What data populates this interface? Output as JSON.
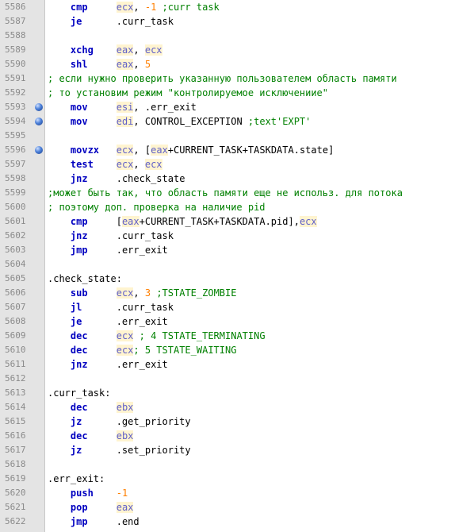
{
  "editor": {
    "lines": [
      {
        "n": "5586",
        "bp": false,
        "tokens": [
          {
            "t": "    ",
            "c": "txt"
          },
          {
            "t": "cmp",
            "c": "kw"
          },
          {
            "t": "     ",
            "c": "txt"
          },
          {
            "t": "ecx",
            "c": "reg"
          },
          {
            "t": ", ",
            "c": "txt"
          },
          {
            "t": "-1",
            "c": "num"
          },
          {
            "t": " ;curr task",
            "c": "cmt"
          }
        ]
      },
      {
        "n": "5587",
        "bp": false,
        "tokens": [
          {
            "t": "    ",
            "c": "txt"
          },
          {
            "t": "je",
            "c": "kw"
          },
          {
            "t": "      .curr_task",
            "c": "txt"
          }
        ]
      },
      {
        "n": "5588",
        "bp": false,
        "tokens": []
      },
      {
        "n": "5589",
        "bp": false,
        "tokens": [
          {
            "t": "    ",
            "c": "txt"
          },
          {
            "t": "xchg",
            "c": "kw"
          },
          {
            "t": "    ",
            "c": "txt"
          },
          {
            "t": "eax",
            "c": "reg"
          },
          {
            "t": ", ",
            "c": "txt"
          },
          {
            "t": "ecx",
            "c": "reg"
          }
        ]
      },
      {
        "n": "5590",
        "bp": false,
        "tokens": [
          {
            "t": "    ",
            "c": "txt"
          },
          {
            "t": "shl",
            "c": "kw"
          },
          {
            "t": "     ",
            "c": "txt"
          },
          {
            "t": "eax",
            "c": "reg"
          },
          {
            "t": ", ",
            "c": "txt"
          },
          {
            "t": "5",
            "c": "num"
          }
        ]
      },
      {
        "n": "5591",
        "bp": false,
        "tokens": [
          {
            "t": "; если нужно проверить указанную пользователем область памяти",
            "c": "cmt"
          }
        ]
      },
      {
        "n": "5592",
        "bp": false,
        "tokens": [
          {
            "t": "; то установим режим \"контролируемое исключениие\"",
            "c": "cmt"
          }
        ]
      },
      {
        "n": "5593",
        "bp": true,
        "tokens": [
          {
            "t": "    ",
            "c": "txt"
          },
          {
            "t": "mov",
            "c": "kw"
          },
          {
            "t": "     ",
            "c": "txt"
          },
          {
            "t": "esi",
            "c": "reg"
          },
          {
            "t": ", .err_exit",
            "c": "txt"
          }
        ]
      },
      {
        "n": "5594",
        "bp": true,
        "tokens": [
          {
            "t": "    ",
            "c": "txt"
          },
          {
            "t": "mov",
            "c": "kw"
          },
          {
            "t": "     ",
            "c": "txt"
          },
          {
            "t": "edi",
            "c": "reg"
          },
          {
            "t": ", CONTROL_EXCEPTION ",
            "c": "txt"
          },
          {
            "t": ";text'EXPT'",
            "c": "cmt"
          }
        ]
      },
      {
        "n": "5595",
        "bp": false,
        "tokens": []
      },
      {
        "n": "5596",
        "bp": true,
        "tokens": [
          {
            "t": "    ",
            "c": "txt"
          },
          {
            "t": "movzx",
            "c": "kw"
          },
          {
            "t": "   ",
            "c": "txt"
          },
          {
            "t": "ecx",
            "c": "reg"
          },
          {
            "t": ", [",
            "c": "txt"
          },
          {
            "t": "eax",
            "c": "reg"
          },
          {
            "t": "+CURRENT_TASK+TASKDATA.state]",
            "c": "txt"
          }
        ]
      },
      {
        "n": "5597",
        "bp": false,
        "tokens": [
          {
            "t": "    ",
            "c": "txt"
          },
          {
            "t": "test",
            "c": "kw"
          },
          {
            "t": "    ",
            "c": "txt"
          },
          {
            "t": "ecx",
            "c": "reg"
          },
          {
            "t": ", ",
            "c": "txt"
          },
          {
            "t": "ecx",
            "c": "reg"
          }
        ]
      },
      {
        "n": "5598",
        "bp": false,
        "tokens": [
          {
            "t": "    ",
            "c": "txt"
          },
          {
            "t": "jnz",
            "c": "kw"
          },
          {
            "t": "     .check_state",
            "c": "txt"
          }
        ]
      },
      {
        "n": "5599",
        "bp": false,
        "tokens": [
          {
            "t": ";может быть так, что область памяти еще не использ. для потока",
            "c": "cmt"
          }
        ]
      },
      {
        "n": "5600",
        "bp": false,
        "tokens": [
          {
            "t": "; поэтому доп. проверка на наличие pid",
            "c": "cmt"
          }
        ]
      },
      {
        "n": "5601",
        "bp": false,
        "tokens": [
          {
            "t": "    ",
            "c": "txt"
          },
          {
            "t": "cmp",
            "c": "kw"
          },
          {
            "t": "     [",
            "c": "txt"
          },
          {
            "t": "eax",
            "c": "reg"
          },
          {
            "t": "+CURRENT_TASK+TASKDATA.pid],",
            "c": "txt"
          },
          {
            "t": "ecx",
            "c": "reg"
          }
        ]
      },
      {
        "n": "5602",
        "bp": false,
        "tokens": [
          {
            "t": "    ",
            "c": "txt"
          },
          {
            "t": "jnz",
            "c": "kw"
          },
          {
            "t": "     .curr_task",
            "c": "txt"
          }
        ]
      },
      {
        "n": "5603",
        "bp": false,
        "tokens": [
          {
            "t": "    ",
            "c": "txt"
          },
          {
            "t": "jmp",
            "c": "kw"
          },
          {
            "t": "     .err_exit",
            "c": "txt"
          }
        ]
      },
      {
        "n": "5604",
        "bp": false,
        "tokens": []
      },
      {
        "n": "5605",
        "bp": false,
        "tokens": [
          {
            "t": ".check_state:",
            "c": "txt"
          }
        ]
      },
      {
        "n": "5606",
        "bp": false,
        "tokens": [
          {
            "t": "    ",
            "c": "txt"
          },
          {
            "t": "sub",
            "c": "kw"
          },
          {
            "t": "     ",
            "c": "txt"
          },
          {
            "t": "ecx",
            "c": "reg"
          },
          {
            "t": ", ",
            "c": "txt"
          },
          {
            "t": "3",
            "c": "num"
          },
          {
            "t": " ;TSTATE_ZOMBIE",
            "c": "cmt"
          }
        ]
      },
      {
        "n": "5607",
        "bp": false,
        "tokens": [
          {
            "t": "    ",
            "c": "txt"
          },
          {
            "t": "jl",
            "c": "kw"
          },
          {
            "t": "      .curr_task",
            "c": "txt"
          }
        ]
      },
      {
        "n": "5608",
        "bp": false,
        "tokens": [
          {
            "t": "    ",
            "c": "txt"
          },
          {
            "t": "je",
            "c": "kw"
          },
          {
            "t": "      .err_exit",
            "c": "txt"
          }
        ]
      },
      {
        "n": "5609",
        "bp": false,
        "tokens": [
          {
            "t": "    ",
            "c": "txt"
          },
          {
            "t": "dec",
            "c": "kw"
          },
          {
            "t": "     ",
            "c": "txt"
          },
          {
            "t": "ecx",
            "c": "reg"
          },
          {
            "t": " ; 4 TSTATE_TERMINATING",
            "c": "cmt"
          }
        ]
      },
      {
        "n": "5610",
        "bp": false,
        "tokens": [
          {
            "t": "    ",
            "c": "txt"
          },
          {
            "t": "dec",
            "c": "kw"
          },
          {
            "t": "     ",
            "c": "txt"
          },
          {
            "t": "ecx",
            "c": "reg"
          },
          {
            "t": "; 5 TSTATE_WAITING",
            "c": "cmt"
          }
        ]
      },
      {
        "n": "5611",
        "bp": false,
        "tokens": [
          {
            "t": "    ",
            "c": "txt"
          },
          {
            "t": "jnz",
            "c": "kw"
          },
          {
            "t": "     .err_exit",
            "c": "txt"
          }
        ]
      },
      {
        "n": "5612",
        "bp": false,
        "tokens": []
      },
      {
        "n": "5613",
        "bp": false,
        "tokens": [
          {
            "t": ".curr_task:",
            "c": "txt"
          }
        ]
      },
      {
        "n": "5614",
        "bp": false,
        "tokens": [
          {
            "t": "    ",
            "c": "txt"
          },
          {
            "t": "dec",
            "c": "kw"
          },
          {
            "t": "     ",
            "c": "txt"
          },
          {
            "t": "ebx",
            "c": "reg"
          }
        ]
      },
      {
        "n": "5615",
        "bp": false,
        "tokens": [
          {
            "t": "    ",
            "c": "txt"
          },
          {
            "t": "jz",
            "c": "kw"
          },
          {
            "t": "      .get_priority",
            "c": "txt"
          }
        ]
      },
      {
        "n": "5616",
        "bp": false,
        "tokens": [
          {
            "t": "    ",
            "c": "txt"
          },
          {
            "t": "dec",
            "c": "kw"
          },
          {
            "t": "     ",
            "c": "txt"
          },
          {
            "t": "ebx",
            "c": "reg"
          }
        ]
      },
      {
        "n": "5617",
        "bp": false,
        "tokens": [
          {
            "t": "    ",
            "c": "txt"
          },
          {
            "t": "jz",
            "c": "kw"
          },
          {
            "t": "      .set_priority",
            "c": "txt"
          }
        ]
      },
      {
        "n": "5618",
        "bp": false,
        "tokens": []
      },
      {
        "n": "5619",
        "bp": false,
        "tokens": [
          {
            "t": ".err_exit:",
            "c": "txt"
          }
        ]
      },
      {
        "n": "5620",
        "bp": false,
        "tokens": [
          {
            "t": "    ",
            "c": "txt"
          },
          {
            "t": "push",
            "c": "kw"
          },
          {
            "t": "    ",
            "c": "txt"
          },
          {
            "t": "-1",
            "c": "num"
          }
        ]
      },
      {
        "n": "5621",
        "bp": false,
        "tokens": [
          {
            "t": "    ",
            "c": "txt"
          },
          {
            "t": "pop",
            "c": "kw"
          },
          {
            "t": "     ",
            "c": "txt"
          },
          {
            "t": "eax",
            "c": "reg"
          }
        ]
      },
      {
        "n": "5622",
        "bp": false,
        "tokens": [
          {
            "t": "    ",
            "c": "txt"
          },
          {
            "t": "jmp",
            "c": "kw"
          },
          {
            "t": "     .end",
            "c": "txt"
          }
        ]
      }
    ]
  }
}
